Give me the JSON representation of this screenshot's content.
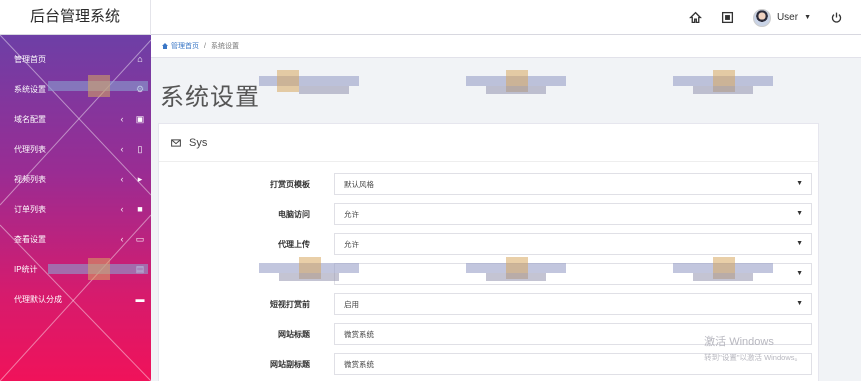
{
  "header": {
    "brand": "后台管理系统",
    "user_label": "User",
    "icons": [
      "home-icon",
      "window-icon",
      "avatar",
      "power-icon"
    ]
  },
  "sidebar": {
    "items": [
      {
        "label": "管理首页",
        "icon": "home-icon"
      },
      {
        "label": "系统设置",
        "icon": "gear-icon"
      },
      {
        "label": "域名配置",
        "icon": "folder-icon"
      },
      {
        "label": "代理列表",
        "icon": "mobile-icon"
      },
      {
        "label": "视频列表",
        "icon": "play-icon"
      },
      {
        "label": "订单列表",
        "icon": "briefcase-icon"
      },
      {
        "label": "查看设置",
        "icon": "monitor-icon"
      },
      {
        "label": "IP统计",
        "icon": "chart-icon"
      },
      {
        "label": "代理默认分成",
        "icon": "card-icon"
      }
    ]
  },
  "breadcrumb": {
    "home": "管理首页",
    "separator": "/",
    "current": "系统设置"
  },
  "page_title": "系统设置",
  "panel": {
    "title": "Sys"
  },
  "form": {
    "rows": [
      {
        "label": "打赏页模板",
        "value": "默认风格"
      },
      {
        "label": "电脑访问",
        "value": "允许"
      },
      {
        "label": "代理上传",
        "value": "允许"
      },
      {
        "label": "",
        "value": ""
      },
      {
        "label": "短视打赏前",
        "value": "启用"
      },
      {
        "label": "网站标题",
        "value": "微赏系统"
      },
      {
        "label": "网站副标题",
        "value": "微赏系统"
      }
    ]
  },
  "windows_watermark": {
    "line1": "激活 Windows",
    "line2": "转到\"设置\"以激活 Windows。"
  },
  "colors": {
    "sidebar_top": "#6d3fa6",
    "sidebar_bottom": "#f0125a",
    "link": "#3a77c6"
  }
}
